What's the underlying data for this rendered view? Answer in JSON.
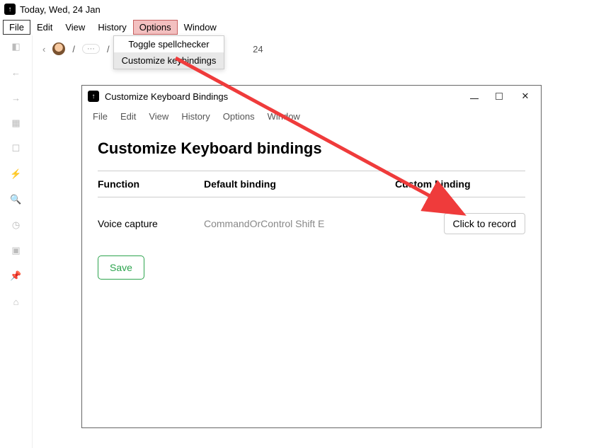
{
  "main_window": {
    "title": "Today, Wed, 24 Jan",
    "menubar": [
      "File",
      "Edit",
      "View",
      "History",
      "Options",
      "Window"
    ],
    "dropdown": {
      "items": [
        "Toggle spellchecker",
        "Customize keybindings"
      ]
    },
    "content_top": {
      "date_fragment": "24"
    }
  },
  "sidebar": {
    "icons": [
      "panel",
      "arrow-left",
      "arrow-right",
      "calendar",
      "inbox",
      "bolt",
      "search",
      "clock",
      "save",
      "pin",
      "drawer"
    ]
  },
  "dialog": {
    "title": "Customize Keyboard Bindings",
    "menubar": [
      "File",
      "Edit",
      "View",
      "History",
      "Options",
      "Window"
    ],
    "heading": "Customize Keyboard bindings",
    "table": {
      "headers": {
        "function": "Function",
        "default": "Default binding",
        "custom": "Custom binding"
      },
      "rows": [
        {
          "function": "Voice capture",
          "default": "CommandOrControl Shift E",
          "record": "Click to record"
        }
      ]
    },
    "save_label": "Save"
  }
}
